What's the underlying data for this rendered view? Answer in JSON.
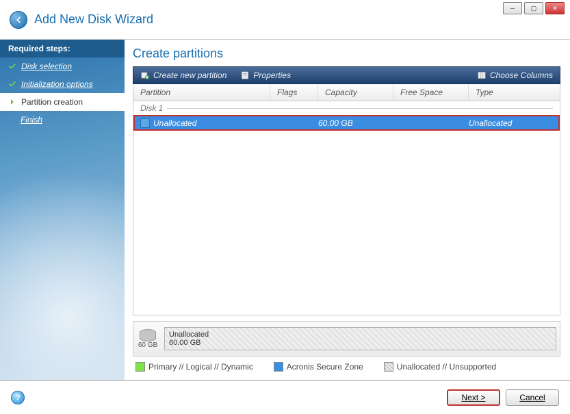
{
  "window": {
    "title": "Add New Disk Wizard"
  },
  "sidebar": {
    "head": "Required steps:",
    "steps": [
      {
        "label": "Disk selection",
        "state": "done"
      },
      {
        "label": "Initialization options",
        "state": "done"
      },
      {
        "label": "Partition creation",
        "state": "current"
      },
      {
        "label": "Finish",
        "state": "future"
      }
    ]
  },
  "main": {
    "title": "Create partitions",
    "toolbar": {
      "create": "Create new partition",
      "properties": "Properties",
      "choose_columns": "Choose Columns"
    },
    "columns": {
      "partition": "Partition",
      "flags": "Flags",
      "capacity": "Capacity",
      "freespace": "Free Space",
      "type": "Type"
    },
    "disk_group": "Disk 1",
    "rows": [
      {
        "partition": "Unallocated",
        "flags": "",
        "capacity": "60.00 GB",
        "freespace": "",
        "type": "Unallocated",
        "selected": true
      }
    ],
    "diskmap": {
      "disk_label": "60 GB",
      "bar_name": "Unallocated",
      "bar_size": "60.00 GB"
    },
    "legend": {
      "primary": "Primary // Logical // Dynamic",
      "secure": "Acronis Secure Zone",
      "unalloc": "Unallocated // Unsupported"
    }
  },
  "footer": {
    "next": "Next >",
    "cancel": "Cancel"
  }
}
